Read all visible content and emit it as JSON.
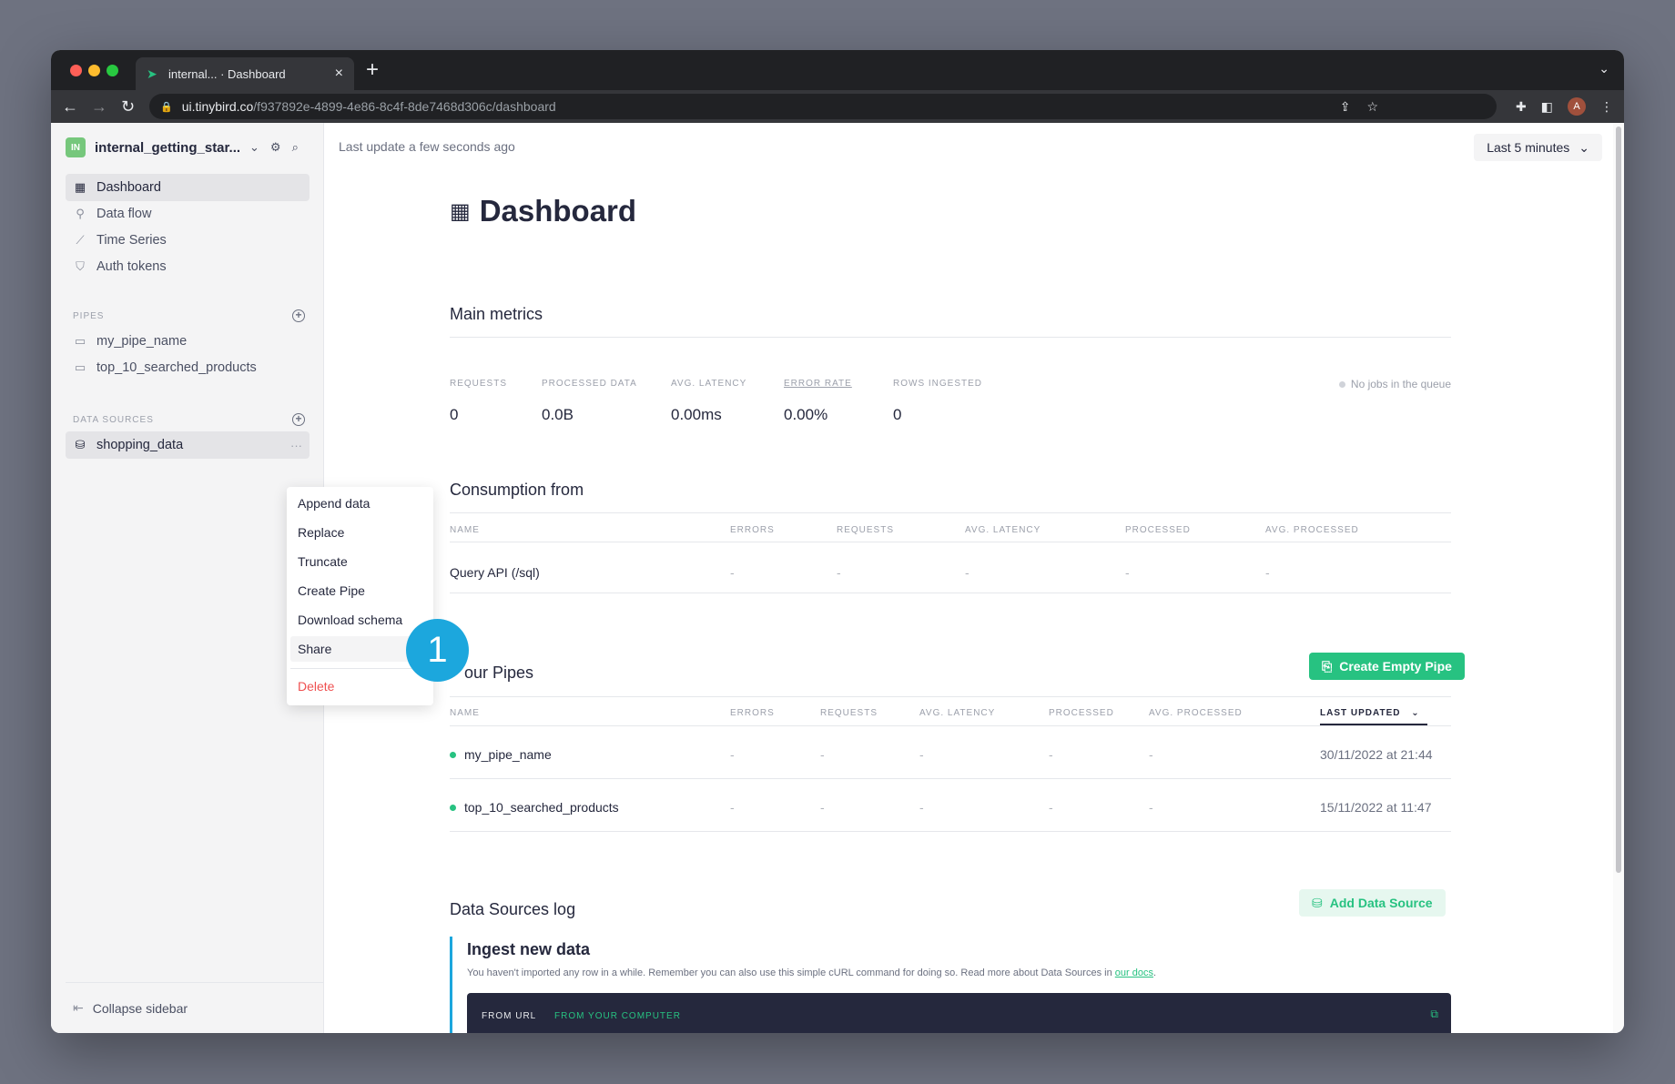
{
  "browser": {
    "tab_title": "internal... · Dashboard",
    "url_host": "ui.tinybird.co",
    "url_path": "/f937892e-4899-4e86-8c4f-8de7468d306c/dashboard",
    "avatar_letter": "A"
  },
  "sidebar": {
    "workspace_badge": "IN",
    "workspace_name": "internal_getting_star...",
    "nav": [
      {
        "label": "Dashboard",
        "icon": "grid-icon"
      },
      {
        "label": "Data flow",
        "icon": "flow-icon"
      },
      {
        "label": "Time Series",
        "icon": "chart-line-icon"
      },
      {
        "label": "Auth tokens",
        "icon": "shield-icon"
      }
    ],
    "pipes_title": "PIPES",
    "pipes": [
      "my_pipe_name",
      "top_10_searched_products"
    ],
    "datasources_title": "DATA SOURCES",
    "datasources": [
      "shopping_data"
    ],
    "collapse_label": "Collapse sidebar"
  },
  "context_menu": {
    "items": [
      "Append data",
      "Replace",
      "Truncate",
      "Create Pipe",
      "Download schema",
      "Share"
    ],
    "danger_item": "Delete"
  },
  "callout": "1",
  "main": {
    "last_update": "Last update a few seconds ago",
    "range": "Last 5 minutes",
    "title": "Dashboard",
    "main_metrics": {
      "title": "Main metrics",
      "labels": [
        "REQUESTS",
        "PROCESSED DATA",
        "AVG. LATENCY",
        "ERROR RATE",
        "ROWS INGESTED"
      ],
      "values": [
        "0",
        "0.0B",
        "0.00ms",
        "0.00%",
        "0"
      ],
      "queue": "No jobs in the queue"
    },
    "consumption": {
      "title": "Consumption from",
      "headers": [
        "NAME",
        "ERRORS",
        "REQUESTS",
        "AVG. LATENCY",
        "PROCESSED",
        "AVG. PROCESSED"
      ],
      "row": [
        "Query API (/sql)",
        "-",
        "-",
        "-",
        "-",
        "-"
      ]
    },
    "pipes": {
      "title": "Your Pipes",
      "title_visible": "our Pipes",
      "create_button": "Create Empty Pipe",
      "headers": [
        "NAME",
        "ERRORS",
        "REQUESTS",
        "AVG. LATENCY",
        "PROCESSED",
        "AVG. PROCESSED",
        "LAST UPDATED"
      ],
      "rows": [
        {
          "name": "my_pipe_name",
          "cells": [
            "-",
            "-",
            "-",
            "-",
            "-"
          ],
          "updated": "30/11/2022 at 21:44"
        },
        {
          "name": "top_10_searched_products",
          "cells": [
            "-",
            "-",
            "-",
            "-",
            "-"
          ],
          "updated": "15/11/2022 at 11:47"
        }
      ]
    },
    "ds_log": {
      "title": "Data Sources log",
      "add_button": "Add Data Source",
      "ingest_title": "Ingest new data",
      "ingest_desc": "You haven't imported any row in a while. Remember you can also use this simple cURL command for doing so. Read more about Data Sources in",
      "ingest_link": "our docs",
      "ingest_end": ".",
      "tab_url": "FROM URL",
      "tab_computer": "FROM YOUR COMPUTER"
    }
  },
  "colors": {
    "accent_green": "#27c281",
    "callout_blue": "#1ca7dd",
    "danger_red": "#ef5050"
  }
}
